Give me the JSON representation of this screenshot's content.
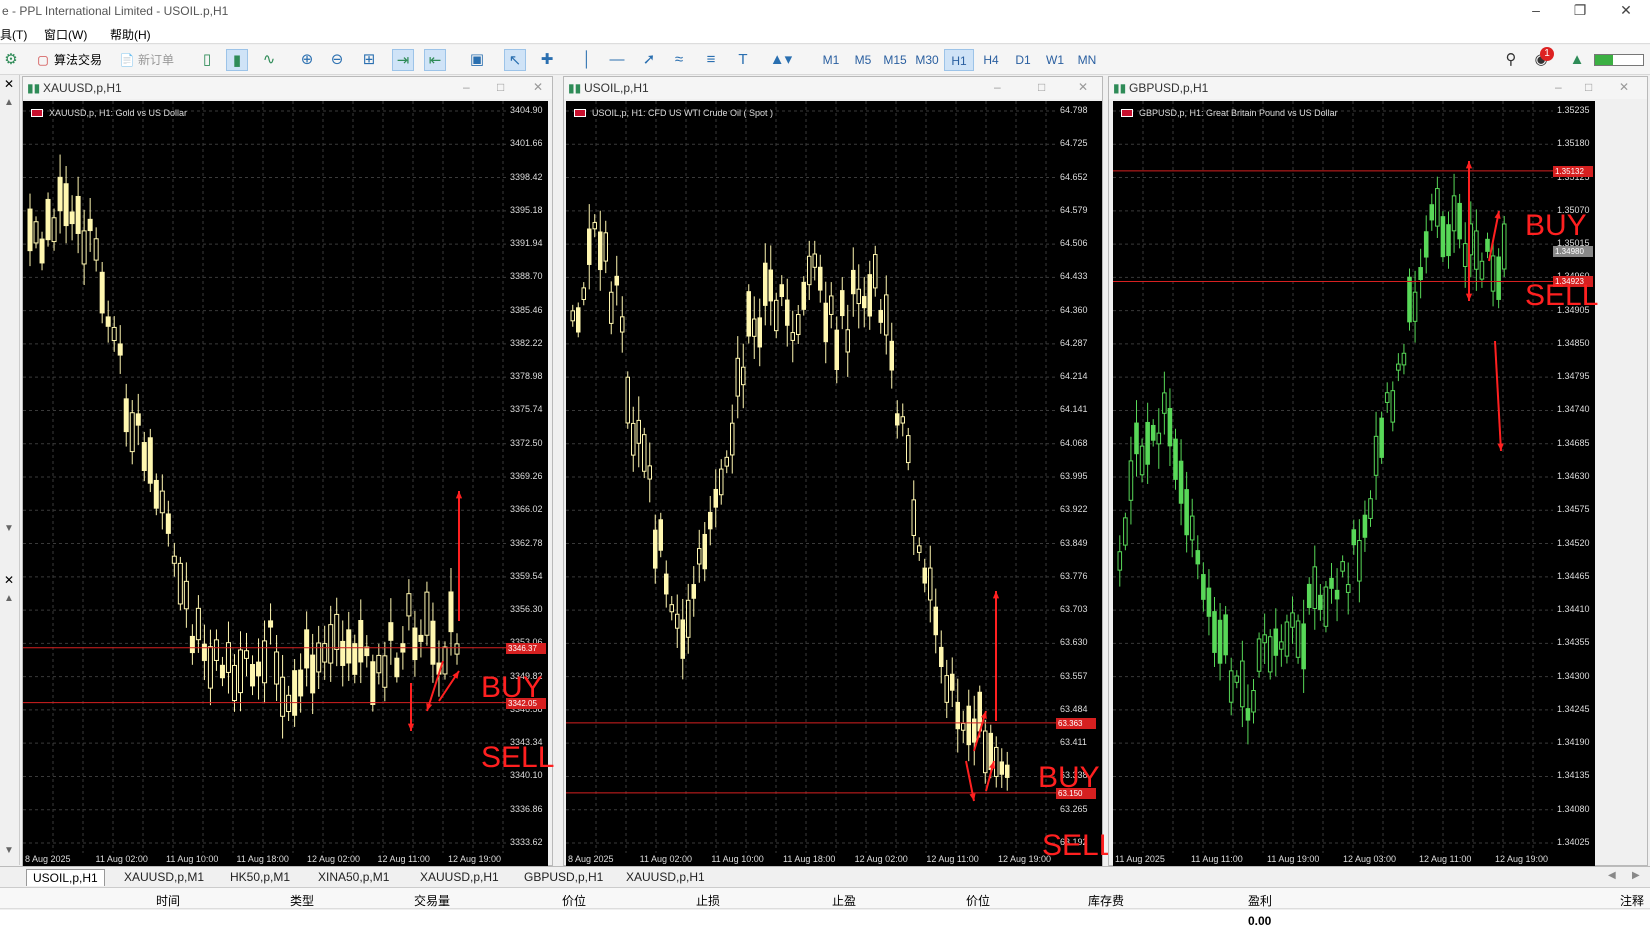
{
  "app": {
    "title": "e - PPL International Limited - USOIL.p,H1"
  },
  "menu": [
    "具(T)",
    "窗口(W)",
    "帮助(H)"
  ],
  "toolbar": {
    "algo_trading": "算法交易",
    "new_order": "新订单",
    "timeframes": [
      "M1",
      "M5",
      "M15",
      "M30",
      "H1",
      "H4",
      "D1",
      "W1",
      "MN"
    ],
    "active_timeframe": "H1",
    "notification_count": "1"
  },
  "colors": {
    "candle_yellow": "#fff7b0",
    "candle_green": "#58d858",
    "grid": "#3a3a3a",
    "level_red": "#d62020",
    "annotation_red": "#ff2020"
  },
  "windows": [
    {
      "title": "XAUUSD,p,H1",
      "chart_header": "XAUUSD,p, H1:  Gold vs US Dollar",
      "price_ticks": [
        "3404.90",
        "3401.66",
        "3398.42",
        "3395.18",
        "3391.94",
        "3388.70",
        "3385.46",
        "3382.22",
        "3378.98",
        "3375.74",
        "3372.50",
        "3369.26",
        "3366.02",
        "3362.78",
        "3359.54",
        "3356.30",
        "3353.06",
        "3349.82",
        "3346.58",
        "3343.34",
        "3340.10",
        "3336.86",
        "3333.62"
      ],
      "red_tags": [
        "3346.37",
        "3342.05"
      ],
      "x_ticks": [
        "8 Aug 2025",
        "11 Aug 02:00",
        "11 Aug 10:00",
        "11 Aug 18:00",
        "12 Aug 02:00",
        "12 Aug 11:00",
        "12 Aug 19:00"
      ],
      "buy_label": "BUY",
      "sell_label": "SELL"
    },
    {
      "title": "USOIL,p,H1",
      "chart_header": "USOIL,p, H1:  CFD US WTI Crude Oil ( Spot )",
      "price_ticks": [
        "64.798",
        "64.725",
        "64.652",
        "64.579",
        "64.506",
        "64.433",
        "64.360",
        "64.287",
        "64.214",
        "64.141",
        "64.068",
        "63.995",
        "63.922",
        "63.849",
        "63.776",
        "63.703",
        "63.630",
        "63.557",
        "63.484",
        "63.411",
        "63.338",
        "63.265",
        "63.192"
      ],
      "red_tags": [
        "63.363",
        "63.150"
      ],
      "x_ticks": [
        "8 Aug 2025",
        "11 Aug 02:00",
        "11 Aug 10:00",
        "11 Aug 18:00",
        "12 Aug 02:00",
        "12 Aug 11:00",
        "12 Aug 19:00"
      ],
      "buy_label": "BUY",
      "sell_label": "SELL"
    },
    {
      "title": "GBPUSD,p,H1",
      "chart_header": "GBPUSD,p, H1:  Great Britain Pound vs US Dollar",
      "price_ticks": [
        "1.35235",
        "1.35180",
        "1.35125",
        "1.35070",
        "1.35015",
        "1.34960",
        "1.34905",
        "1.34850",
        "1.34795",
        "1.34740",
        "1.34685",
        "1.34630",
        "1.34575",
        "1.34520",
        "1.34465",
        "1.34410",
        "1.34355",
        "1.34300",
        "1.34245",
        "1.34190",
        "1.34135",
        "1.34080",
        "1.34025"
      ],
      "red_tags": [
        "1.35132",
        "1.34923"
      ],
      "gray_tag": "1.34980",
      "x_ticks": [
        "11 Aug 2025",
        "11 Aug 11:00",
        "11 Aug 19:00",
        "12 Aug 03:00",
        "12 Aug 11:00",
        "12 Aug 19:00"
      ],
      "buy_label": "BUY",
      "sell_label": "SELL"
    }
  ],
  "tabs": [
    "USOIL,p,H1",
    "XAUUSD,p,M1",
    "HK50,p,M1",
    "XINA50,p,M1",
    "XAUUSD,p,H1",
    "GBPUSD,p,H1",
    "XAUUSD,p,H1"
  ],
  "active_tab": "USOIL,p,H1",
  "terminal": {
    "headers": [
      "时间",
      "类型",
      "交易量",
      "价位",
      "止损",
      "止盈",
      "价位",
      "库存费",
      "盈利",
      "注释"
    ],
    "profit": "0.00"
  }
}
